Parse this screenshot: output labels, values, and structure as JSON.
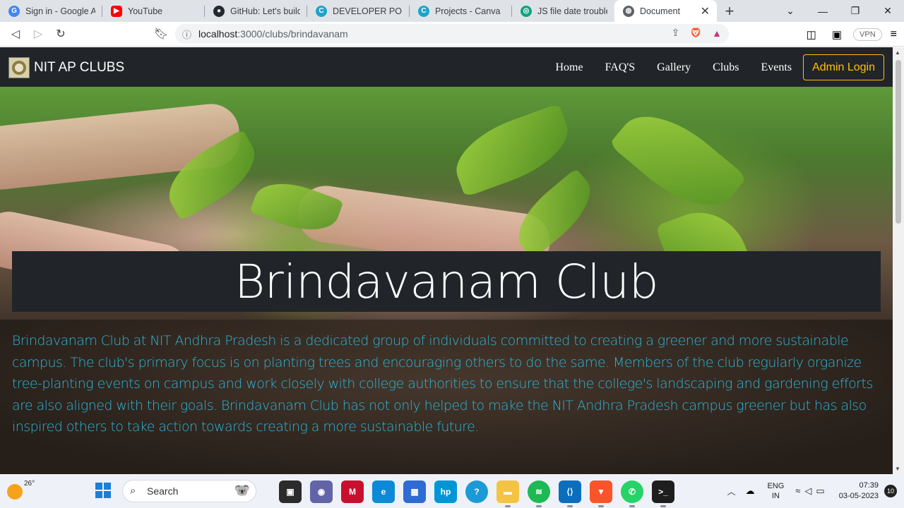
{
  "browser": {
    "tabs": [
      {
        "label": "Sign in - Google Acc",
        "icon": "google-icon",
        "color": "#4285f4"
      },
      {
        "label": "YouTube",
        "icon": "youtube-icon",
        "color": "#ff0000"
      },
      {
        "label": "GitHub: Let's build f",
        "icon": "github-icon",
        "color": "#24292f"
      },
      {
        "label": "DEVELOPER PORTFO",
        "icon": "canva-icon",
        "color": "#1fa3c8"
      },
      {
        "label": "Projects - Canva",
        "icon": "canva-icon",
        "color": "#1fa3c8"
      },
      {
        "label": "JS file date troublesh",
        "icon": "chatgpt-icon",
        "color": "#10a37f"
      },
      {
        "label": "Document",
        "icon": "globe-icon",
        "color": "#5f6368"
      }
    ],
    "url_host": "localhost",
    "url_path": ":3000/clubs/brindavanam",
    "vpn_label": "VPN"
  },
  "site": {
    "brand": "NIT AP CLUBS",
    "nav": [
      "Home",
      "FAQ'S",
      "Gallery",
      "Clubs",
      "Events"
    ],
    "admin_login": "Admin Login"
  },
  "page": {
    "title": "Brindavanam Club",
    "description": "Brindavanam Club at NIT Andhra Pradesh is a dedicated group of individuals committed to creating a greener and more sustainable campus. The club's primary focus is on planting trees and encouraging others to do the same. Members of the club regularly organize tree-planting events on campus and work closely with college authorities to ensure that the college's landscaping and gardening efforts are also aligned with their goals. Brindavanam Club has not only helped to make the NIT Andhra Pradesh campus greener but has also inspired others to take action towards creating a more sustainable future."
  },
  "taskbar": {
    "temperature": "26°",
    "search_placeholder": "Search",
    "lang_line1": "ENG",
    "lang_line2": "IN",
    "time": "07:39",
    "date": "03-05-2023",
    "notifications": "10",
    "search_logo_text": "🐨"
  },
  "colors": {
    "navbar": "#212529",
    "admin_accent": "#ffc107",
    "description_text": "#2eb6d8"
  }
}
